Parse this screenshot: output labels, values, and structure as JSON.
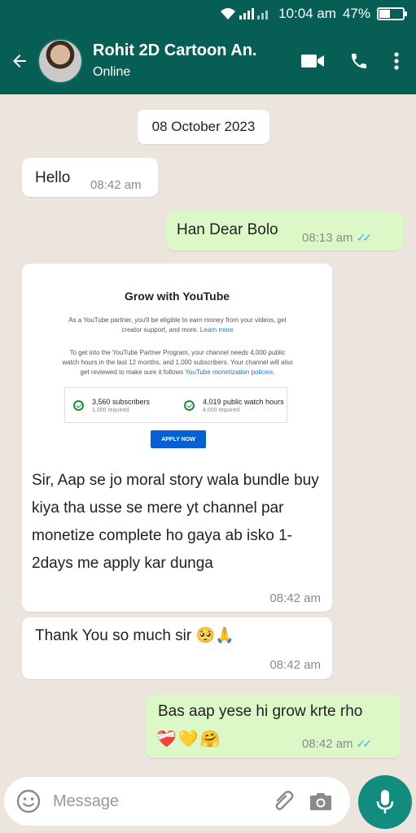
{
  "status_bar": {
    "time": "10:04 am",
    "battery": "47%",
    "battery_level": 0.47,
    "icons": [
      "wifi-icon",
      "signal-icon",
      "battery-icon"
    ]
  },
  "header": {
    "contact_name": "Rohit 2D Cartoon An.",
    "status": "Online",
    "icons": [
      "back-arrow-icon",
      "video-call-icon",
      "phone-icon",
      "more-vert-icon"
    ]
  },
  "chat": {
    "date": "08 October 2023",
    "messages": [
      {
        "direction": "in",
        "text": "Hello",
        "time": "08:42 am"
      },
      {
        "direction": "out",
        "text": "Han Dear Bolo",
        "time": "08:13 am",
        "ticks": "✓✓"
      },
      {
        "direction": "in",
        "image": {
          "title": "Grow with YouTube",
          "para1": "As a YouTube partner, you'll be eligible to earn money from your videos, get creator support, and more.",
          "para1_link": "Learn more",
          "para2": "To get into the YouTube Partner Program, your channel needs 4,000 public watch hours in the last 12 months, and 1,000 subscribers. Your channel will also get reviewed to make sure it follows",
          "para2_link": "YouTube monetization policies.",
          "stat1_main": "3,560 subscribers",
          "stat1_sub": "1,000 required",
          "stat2_main": "4,019 public watch hours",
          "stat2_sub": "4,000 required",
          "button": "APPLY NOW"
        },
        "text": "Sir, Aap se jo moral story wala bundle buy kiya tha usse se mere yt channel par monetize complete ho gaya ab isko 1-2days me apply kar dunga",
        "time": "08:42 am"
      },
      {
        "direction": "in",
        "text": "Thank You so much sir 🥺🙏",
        "time": "08:42 am"
      },
      {
        "direction": "out",
        "text": "Bas aap yese hi grow krte rho",
        "emojis": "❤️‍🩹💛🤗",
        "time": "08:42 am",
        "ticks": "✓✓"
      }
    ]
  },
  "composer": {
    "placeholder": "Message",
    "icons": [
      "emoji-icon",
      "attach-icon",
      "camera-icon",
      "mic-icon"
    ]
  },
  "colors": {
    "header": "#075e54",
    "background": "#ece5dd",
    "outgoing_bubble": "#dcf8c6",
    "mic_button": "#128c7e",
    "read_ticks": "#4fb3e0"
  }
}
